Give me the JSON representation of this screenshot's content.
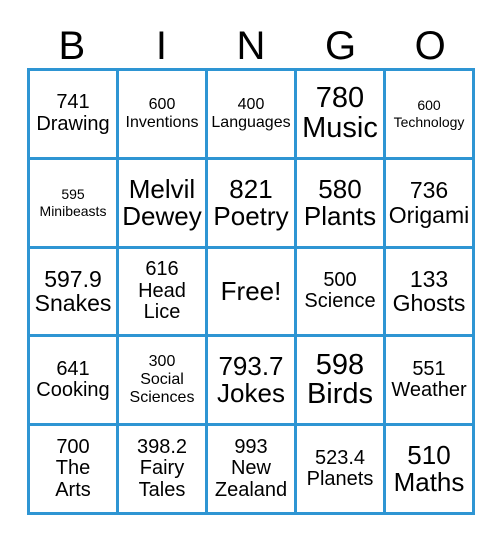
{
  "card": {
    "type": "bingo-card",
    "title_letters": [
      "B",
      "I",
      "N",
      "G",
      "O"
    ],
    "colors": {
      "border": "#2E95D3",
      "background": "#FFFFFF",
      "text": "#000000"
    },
    "grid": {
      "columns": 5,
      "rows": 5,
      "free_space": {
        "row": 3,
        "column": 3,
        "label": "Free!"
      }
    }
  },
  "header": {
    "letters": [
      {
        "label": "B"
      },
      {
        "label": "I"
      },
      {
        "label": "N"
      },
      {
        "label": "G"
      },
      {
        "label": "O"
      }
    ]
  },
  "cells": [
    {
      "id": "r1c1",
      "text": "741\nDrawing",
      "size": "md"
    },
    {
      "id": "r1c2",
      "text": "600\nInventions",
      "size": "sm"
    },
    {
      "id": "r1c3",
      "text": "400\nLanguages",
      "size": "sm"
    },
    {
      "id": "r1c4",
      "text": "780\nMusic",
      "size": "xxl"
    },
    {
      "id": "r1c5",
      "text": "600\nTechnology",
      "size": "xs"
    },
    {
      "id": "r2c1",
      "text": "595\nMinibeasts",
      "size": "xs"
    },
    {
      "id": "r2c2",
      "text": "Melvil\nDewey",
      "size": "xl"
    },
    {
      "id": "r2c3",
      "text": "821\nPoetry",
      "size": "xl"
    },
    {
      "id": "r2c4",
      "text": "580\nPlants",
      "size": "xl"
    },
    {
      "id": "r2c5",
      "text": "736\nOrigami",
      "size": "lg"
    },
    {
      "id": "r3c1",
      "text": "597.9\nSnakes",
      "size": "lg"
    },
    {
      "id": "r3c2",
      "text": "616\nHead\nLice",
      "size": "md"
    },
    {
      "id": "r3c3",
      "text": "Free!",
      "size": "xl"
    },
    {
      "id": "r3c4",
      "text": "500\nScience",
      "size": "md"
    },
    {
      "id": "r3c5",
      "text": "133\nGhosts",
      "size": "lg"
    },
    {
      "id": "r4c1",
      "text": "641\nCooking",
      "size": "md"
    },
    {
      "id": "r4c2",
      "text": "300\nSocial\nSciences",
      "size": "sm"
    },
    {
      "id": "r4c3",
      "text": "793.7\nJokes",
      "size": "xl"
    },
    {
      "id": "r4c4",
      "text": "598\nBirds",
      "size": "xxl"
    },
    {
      "id": "r4c5",
      "text": "551\nWeather",
      "size": "md"
    },
    {
      "id": "r5c1",
      "text": "700\nThe\nArts",
      "size": "md"
    },
    {
      "id": "r5c2",
      "text": "398.2\nFairy\nTales",
      "size": "md"
    },
    {
      "id": "r5c3",
      "text": "993\nNew\nZealand",
      "size": "md"
    },
    {
      "id": "r5c4",
      "text": "523.4\nPlanets",
      "size": "md"
    },
    {
      "id": "r5c5",
      "text": "510\nMaths",
      "size": "xl"
    }
  ]
}
